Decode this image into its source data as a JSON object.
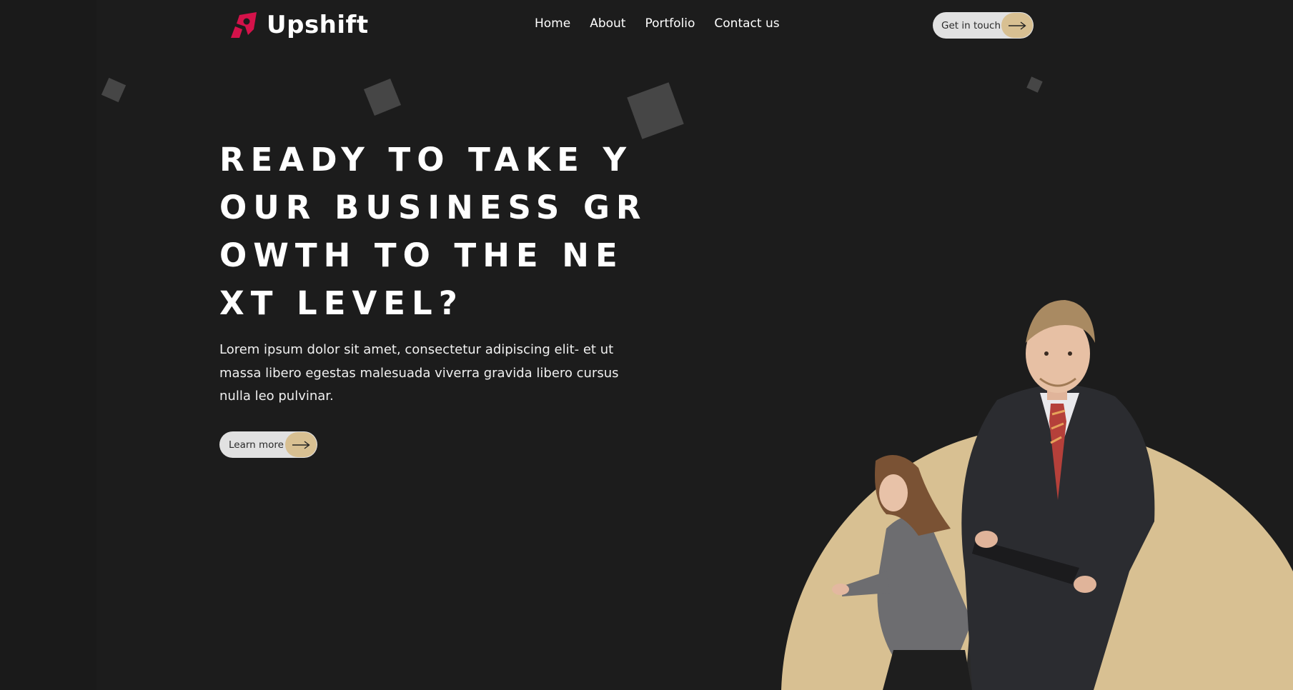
{
  "brand": {
    "name": "Upshift",
    "logo_icon": "rocket-icon",
    "logo_color": "#d4124a"
  },
  "nav": {
    "items": [
      "Home",
      "About",
      "Portfolio",
      "Contact us"
    ]
  },
  "header_cta": {
    "label": "Get in touch",
    "icon": "arrow-right-icon"
  },
  "hero": {
    "title": "READY TO TAKE YOUR BUSINESS GROWTH TO THE NEXT LEVEL?",
    "description": "Lorem ipsum dolor sit amet, consectetur adipiscing elit- et ut massa libero egestas malesuada viverra gravida libero cursus nulla leo pulvinar.",
    "button_label": "Learn more",
    "button_icon": "arrow-right-icon",
    "image_alt": "business-people-photo"
  },
  "colors": {
    "background": "#1c1c1c",
    "accent_gold": "#d8c092",
    "button_bg": "#e1e1e1",
    "brand_red": "#d4124a",
    "decor_square": "#464646"
  }
}
